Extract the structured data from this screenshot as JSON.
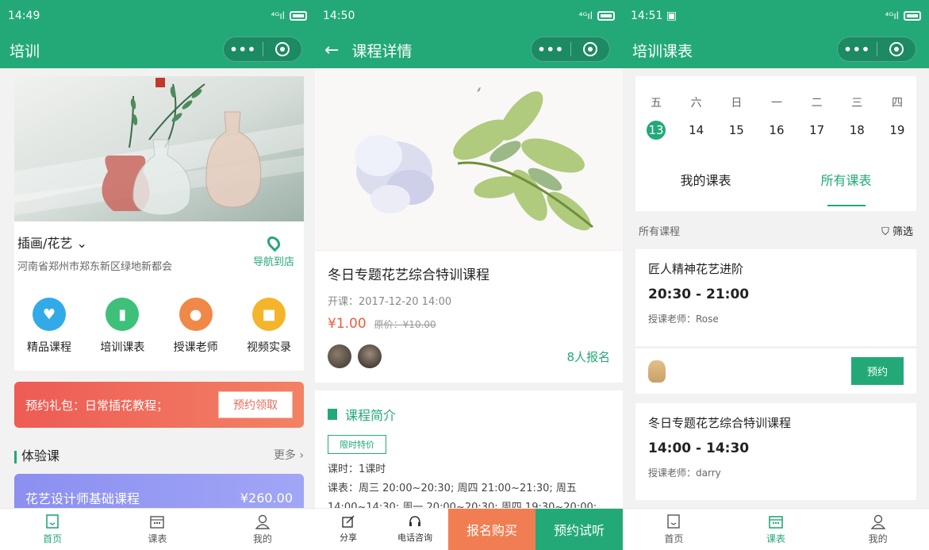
{
  "colors": {
    "brand": "#23a978",
    "price": "#ef5a3c",
    "promo": "#ee5b55",
    "buy": "#f07e52",
    "course_card": "#8b8ff0"
  },
  "phone1": {
    "status": {
      "time": "14:49",
      "signal": "4G"
    },
    "title": "培训",
    "location": {
      "category": "插画/花艺",
      "address": "河南省郑州市郑东新区绿地新都会",
      "nav_label": "导航到店"
    },
    "menu": [
      {
        "label": "精品课程",
        "icon": "heart-icon",
        "color": "#33aae8"
      },
      {
        "label": "培训课表",
        "icon": "book-icon",
        "color": "#3ec07a"
      },
      {
        "label": "授课老师",
        "icon": "teacher-icon",
        "color": "#f08848"
      },
      {
        "label": "视频实录",
        "icon": "video-icon",
        "color": "#f5b52a"
      }
    ],
    "promo": {
      "text": "预约礼包：日常插花教程；",
      "button": "预约领取"
    },
    "section": {
      "title": "体验课",
      "more": "更多"
    },
    "course": {
      "name": "花艺设计师基础课程",
      "price": "¥260.00"
    },
    "tabs": [
      {
        "label": "首页",
        "icon": "home-icon"
      },
      {
        "label": "课表",
        "icon": "calendar-icon"
      },
      {
        "label": "我的",
        "icon": "user-icon"
      }
    ]
  },
  "phone2": {
    "status": {
      "time": "14:50",
      "signal": "4G"
    },
    "title": "课程详情",
    "course": {
      "title": "冬日专题花艺综合特训课程",
      "start": "开课：2017-12-20 14:00",
      "price": "¥1.00",
      "original_price": "原价：¥10.00",
      "enrolled": "8人报名"
    },
    "intro": {
      "title": "课程简介",
      "tag": "限时特价",
      "hours": "课时：1课时",
      "schedule": "课表：周三 20:00~20:30; 周四 21:00~21:30; 周五 14:00~14:30; 周一 20:00~20:30; 周四 19:30~20:00;"
    },
    "bottom": {
      "share": "分享",
      "phone": "电话咨询",
      "buy": "报名购买",
      "trial": "预约试听"
    }
  },
  "phone3": {
    "status": {
      "time": "14:51",
      "signal": "4G"
    },
    "title": "培训课表",
    "weekdays": [
      "五",
      "六",
      "日",
      "一",
      "二",
      "三",
      "四"
    ],
    "dates": [
      "13",
      "14",
      "15",
      "16",
      "17",
      "18",
      "19"
    ],
    "today_index": 0,
    "tabs": [
      "我的课表",
      "所有课表"
    ],
    "active_tab": 1,
    "filter": {
      "label": "所有课程",
      "button": "筛选"
    },
    "classes": [
      {
        "name": "匠人精神花艺进阶",
        "time": "20:30 - 21:00",
        "teacher": "授课老师：Rose",
        "action": "预约"
      },
      {
        "name": "冬日专题花艺综合特训课程",
        "time": "14:00 - 14:30",
        "teacher": "授课老师：darry"
      }
    ],
    "tabbar": [
      {
        "label": "首页",
        "icon": "home-icon"
      },
      {
        "label": "课表",
        "icon": "calendar-icon"
      },
      {
        "label": "我的",
        "icon": "user-icon"
      }
    ],
    "active_tabbar": 1
  }
}
